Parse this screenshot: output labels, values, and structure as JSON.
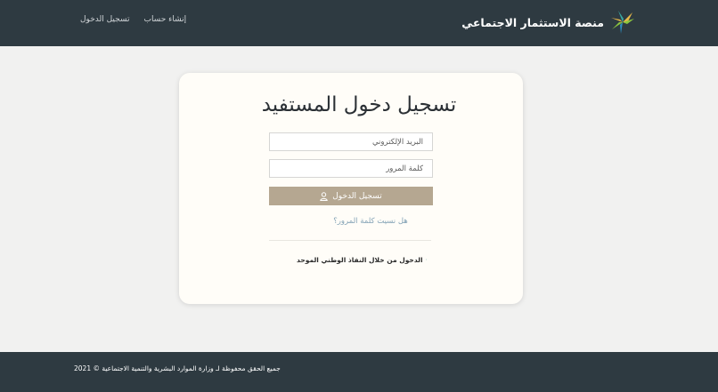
{
  "header": {
    "brand_name": "منصة الاستثمار الاجتماعي",
    "logo_icon": "palm-star-logo",
    "nav": {
      "login_label": "تسجيل الدخول",
      "register_label": "إنشاء حساب"
    }
  },
  "login_card": {
    "title": "تسجيل دخول المستفيد",
    "email_placeholder": "البريد الإلكتروني",
    "password_placeholder": "كلمة المرور",
    "login_button_label": "تسجيل الدخول",
    "login_button_icon": "user-icon",
    "forgot_password_label": "هل نسيت كلمة المرور؟",
    "nafath_label": "الدخول من خلال النفاذ الوطني الموحد",
    "nafath_icon": "nafath-logo-icon"
  },
  "footer": {
    "copyright": "جميع الحقق محفوظة لـ وزارة الموارد البشرية والتنمية الاجتماعية © 2021"
  },
  "colors": {
    "header_bg": "#2e3a41",
    "footer_bg": "#2e3a41",
    "button_bg": "#b5a791",
    "link": "#84a3b6",
    "page_bg": "#f1f1f0",
    "card_bg": "#fffdf8"
  }
}
